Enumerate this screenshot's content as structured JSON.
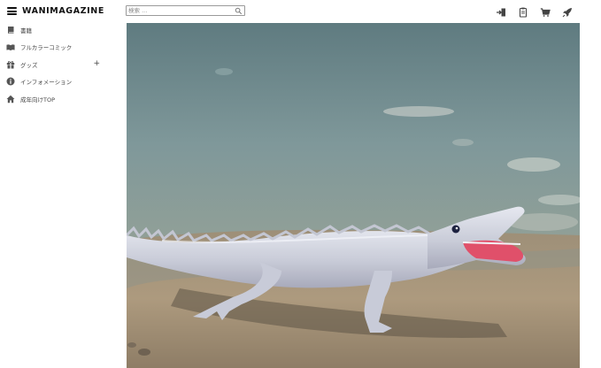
{
  "header": {
    "logo": "WANIMAGAZINE",
    "search": {
      "placeholder": "検索 ..."
    },
    "icons": [
      "login-icon",
      "document-icon",
      "cart-icon",
      "rocket-icon"
    ]
  },
  "sidebar": {
    "items": [
      {
        "label": "書籍",
        "icon": "book-icon"
      },
      {
        "label": "フルカラーコミック",
        "icon": "open-book-icon"
      },
      {
        "label": "グッズ",
        "icon": "gift-icon",
        "expand": "+"
      },
      {
        "label": "インフォメーション",
        "icon": "info-icon"
      },
      {
        "label": "成年向けTOP",
        "icon": "home-icon"
      }
    ]
  },
  "hero": {
    "image": "white toy alligator on beach at shoreline"
  }
}
